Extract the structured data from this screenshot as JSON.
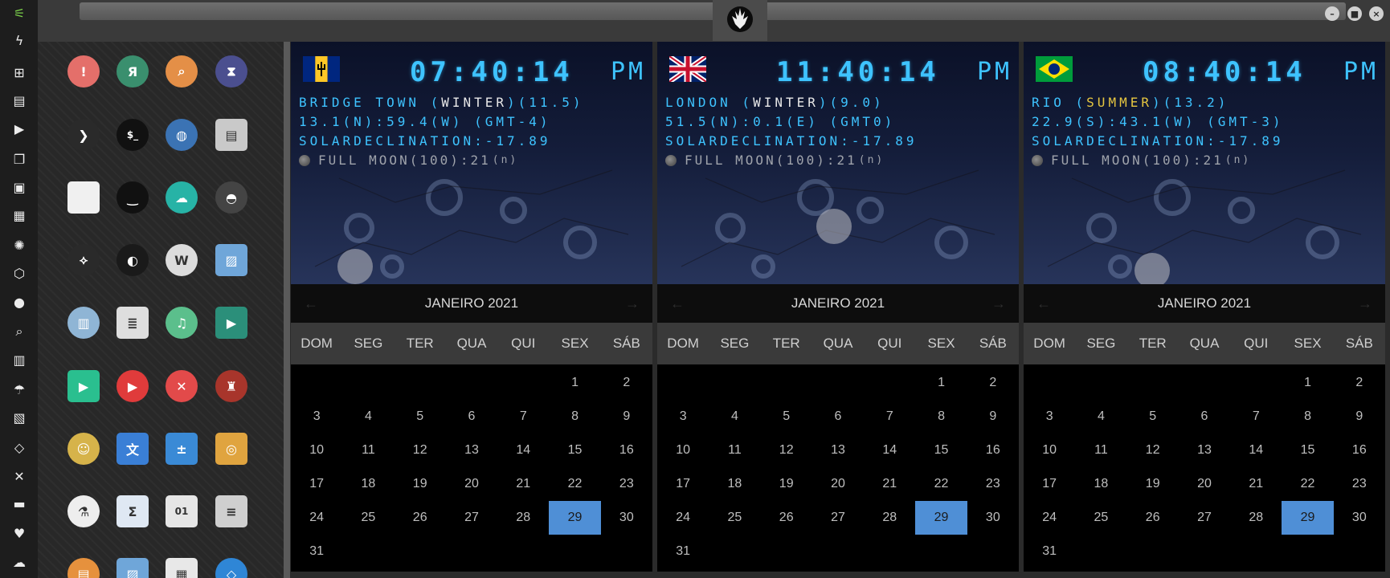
{
  "sidebar": {
    "items": [
      {
        "icon": "wifi-icon",
        "glyph": "⚟"
      },
      {
        "icon": "flash-icon",
        "glyph": "ϟ"
      },
      {
        "icon": "windows-icon",
        "glyph": "⊞"
      },
      {
        "icon": "archive-icon",
        "glyph": "▤"
      },
      {
        "icon": "play-icon",
        "glyph": "▶"
      },
      {
        "icon": "map-book-icon",
        "glyph": "❐"
      },
      {
        "icon": "image-icon",
        "glyph": "▣"
      },
      {
        "icon": "news-icon",
        "glyph": "▦"
      },
      {
        "icon": "rebel-icon",
        "glyph": "✺"
      },
      {
        "icon": "hexagon-icon",
        "glyph": "⬡"
      },
      {
        "icon": "globe-icon",
        "glyph": "●"
      },
      {
        "icon": "search-icon",
        "glyph": "⌕"
      },
      {
        "icon": "map-icon",
        "glyph": "▥"
      },
      {
        "icon": "umbrella-icon",
        "glyph": "☂"
      },
      {
        "icon": "contacts-icon",
        "glyph": "▧"
      },
      {
        "icon": "code-icon",
        "glyph": "◇"
      },
      {
        "icon": "expand-icon",
        "glyph": "✕"
      },
      {
        "icon": "youtube-icon",
        "glyph": "▬"
      },
      {
        "icon": "heart-icon",
        "glyph": "♥"
      },
      {
        "icon": "cloud-icon",
        "glyph": "☁"
      }
    ]
  },
  "topbar": {
    "emblem": "rebel-alliance-icon"
  },
  "window_controls": {
    "minimize": "–",
    "maximize": "■",
    "close": "×"
  },
  "apps": [
    {
      "name": "warning",
      "color": "#e46f6a",
      "glyph": "!"
    },
    {
      "name": "yandex",
      "color": "#3a8f6e",
      "glyph": "Я"
    },
    {
      "name": "search",
      "color": "#e48f47",
      "glyph": "⌕"
    },
    {
      "name": "hourglass",
      "color": "#4b4f8f",
      "glyph": "⧗"
    },
    {
      "name": "terminal-arrow",
      "color": "#2a2a2a",
      "glyph": "❯"
    },
    {
      "name": "console",
      "color": "#111111",
      "glyph": "$_"
    },
    {
      "name": "web-browser",
      "color": "#3b73b4",
      "glyph": "◍"
    },
    {
      "name": "drive",
      "color": "#c9c9c9",
      "glyph": "▤"
    },
    {
      "name": "window",
      "color": "#f0f0f0",
      "glyph": ""
    },
    {
      "name": "wave",
      "color": "#111111",
      "glyph": "‿"
    },
    {
      "name": "cloud-lock",
      "color": "#27b3a6",
      "glyph": "☁"
    },
    {
      "name": "github",
      "color": "#444444",
      "glyph": "◓"
    },
    {
      "name": "starfleet",
      "color": "#2a2a2a",
      "glyph": "⟡"
    },
    {
      "name": "death-star",
      "color": "#1a1a1a",
      "glyph": "◐"
    },
    {
      "name": "wikipedia",
      "color": "#dcdcdc",
      "glyph": "W"
    },
    {
      "name": "world-map",
      "color": "#6fa6d9",
      "glyph": "▨"
    },
    {
      "name": "library",
      "color": "#8fb5d5",
      "glyph": "▥"
    },
    {
      "name": "notes",
      "color": "#dedede",
      "glyph": "≣"
    },
    {
      "name": "music",
      "color": "#5bbf8c",
      "glyph": "♫"
    },
    {
      "name": "video",
      "color": "#2b8f7a",
      "glyph": "▶"
    },
    {
      "name": "player",
      "color": "#2abf8f",
      "glyph": "▶"
    },
    {
      "name": "youtube",
      "color": "#e03b3b",
      "glyph": "▶"
    },
    {
      "name": "close-app",
      "color": "#e24a4a",
      "glyph": "✕"
    },
    {
      "name": "iron-man",
      "color": "#a8352b",
      "glyph": "♜"
    },
    {
      "name": "c3po",
      "color": "#d6b34a",
      "glyph": "☺"
    },
    {
      "name": "translate",
      "color": "#3a7fd6",
      "glyph": "文"
    },
    {
      "name": "calculator",
      "color": "#3a8ad6",
      "glyph": "±"
    },
    {
      "name": "photos",
      "color": "#e0a43f",
      "glyph": "◎"
    },
    {
      "name": "chemistry",
      "color": "#eeeeee",
      "glyph": "⚗"
    },
    {
      "name": "sigma",
      "color": "#dfe8f3",
      "glyph": "Σ"
    },
    {
      "name": "binary",
      "color": "#e6e6e6",
      "glyph": "01"
    },
    {
      "name": "text-editor",
      "color": "#cfcfcf",
      "glyph": "≡"
    },
    {
      "name": "document",
      "color": "#e6913d",
      "glyph": "▤"
    },
    {
      "name": "image-viewer",
      "color": "#6fa6d9",
      "glyph": "▨"
    },
    {
      "name": "presentation",
      "color": "#e8e8e8",
      "glyph": "▦"
    },
    {
      "name": "vscode",
      "color": "#2f86d6",
      "glyph": "◇"
    }
  ],
  "weekdays": [
    "DOM",
    "SEG",
    "TER",
    "QUA",
    "QUI",
    "SEX",
    "SÁB"
  ],
  "weeks": [
    [
      "",
      "",
      "",
      "",
      "",
      "1",
      "2"
    ],
    [
      "3",
      "4",
      "5",
      "6",
      "7",
      "8",
      "9"
    ],
    [
      "10",
      "11",
      "12",
      "13",
      "14",
      "15",
      "16"
    ],
    [
      "17",
      "18",
      "19",
      "20",
      "21",
      "22",
      "23"
    ],
    [
      "24",
      "25",
      "26",
      "27",
      "28",
      "29",
      "30"
    ],
    [
      "31",
      "",
      "",
      "",
      "",
      "",
      ""
    ]
  ],
  "selected_day": "29",
  "cities": [
    {
      "flag": "barbados-flag-icon",
      "time": "07:40:14",
      "ampm": "PM",
      "line1_prefix": "BRIDGE TOWN (",
      "season": "WINTER",
      "line1_suffix": ")(11.5)",
      "line2": "13.1(N):59.4(W) (GMT-4)",
      "line3": "SOLARDECLINATION:-17.89",
      "moon_text": "FULL MOON(100):21",
      "moon_unit": "(n)",
      "month": "JANEIRO 2021"
    },
    {
      "flag": "uk-flag-icon",
      "time": "11:40:14",
      "ampm": "PM",
      "line1_prefix": "LONDON (",
      "season": "WINTER",
      "line1_suffix": ")(9.0)",
      "line2": "51.5(N):0.1(E) (GMT0)",
      "line3": "SOLARDECLINATION:-17.89",
      "moon_text": "FULL MOON(100):21",
      "moon_unit": "(n)",
      "month": "JANEIRO 2021"
    },
    {
      "flag": "brazil-flag-icon",
      "time": "08:40:14",
      "ampm": "PM",
      "line1_prefix": "RIO (",
      "season": "SUMMER",
      "line1_suffix": ")(13.2)",
      "line2": "22.9(S):43.1(W) (GMT-3)",
      "line3": "SOLARDECLINATION:-17.89",
      "moon_text": "FULL MOON(100):21",
      "moon_unit": "(n)",
      "month": "JANEIRO 2021"
    }
  ],
  "colors": {
    "clock": "#3ec3ff",
    "summer": "#e6c640",
    "winter": "#e8e8e8",
    "selected": "#4f8fd6"
  }
}
